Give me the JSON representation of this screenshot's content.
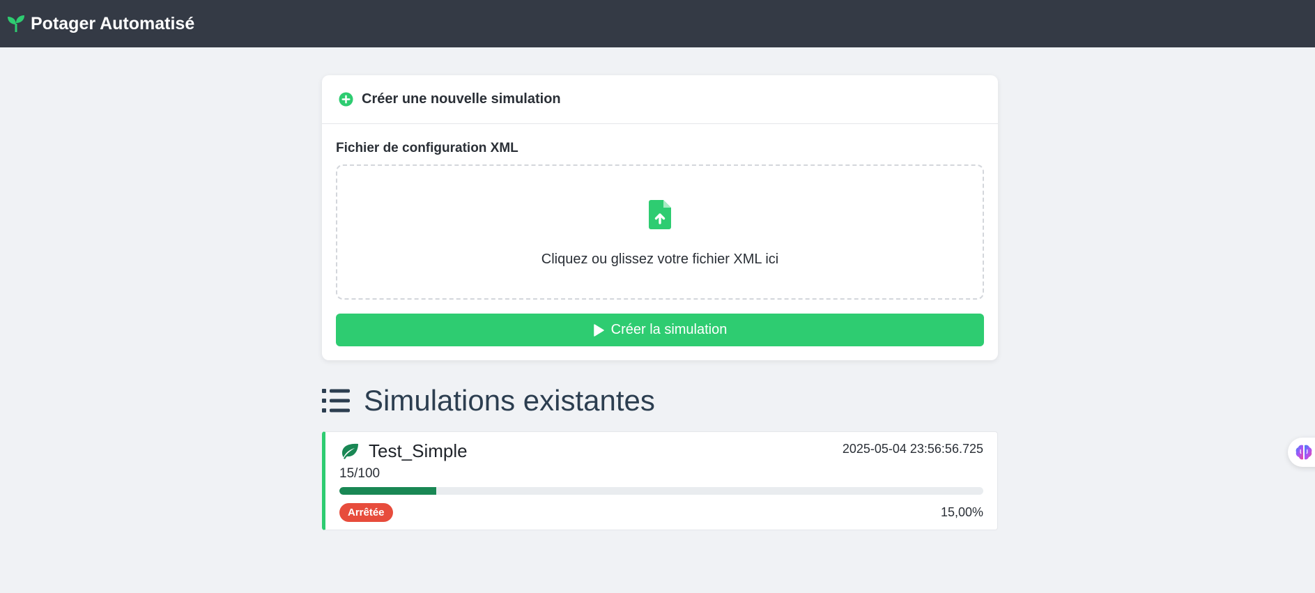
{
  "navbar": {
    "brand_icon": "seedling-icon",
    "brand_title": "Potager Automatisé"
  },
  "create_card": {
    "header_icon": "plus-circle-icon",
    "header_title": "Créer une nouvelle simulation",
    "field_label": "Fichier de configuration XML",
    "dropzone_icon": "file-upload-icon",
    "dropzone_text": "Cliquez ou glissez votre fichier XML ici",
    "button_icon": "play-icon",
    "button_label": "Créer la simulation"
  },
  "simulations": {
    "section_icon": "list-icon",
    "section_title": "Simulations existantes",
    "items": [
      {
        "icon": "leaf-icon",
        "name": "Test_Simple",
        "date": "2025-05-04 23:56:56.725",
        "progress_text": "15/100",
        "progress_fraction": 0.15,
        "status": "Arrêtée",
        "percent": "15,00%"
      }
    ]
  },
  "side_widget": {
    "icon": "brain-icon"
  },
  "colors": {
    "navbar_bg": "#343a45",
    "accent_green": "#2ecc71",
    "progress_green": "#198754",
    "status_red": "#e74c3c",
    "page_bg": "#f0f2f5"
  }
}
